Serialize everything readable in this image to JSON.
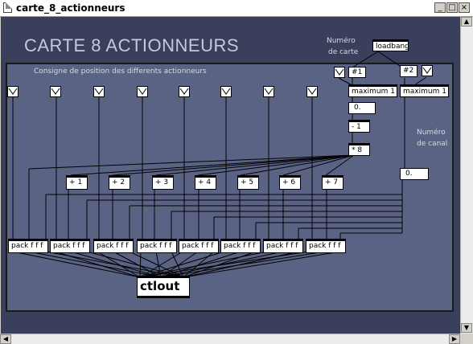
{
  "window": {
    "title": "carte_8_actionneurs"
  },
  "header": {
    "title": "CARTE 8 ACTIONNEURS",
    "card_label_line1": "Numéro",
    "card_label_line2": "de carte"
  },
  "panel": {
    "caption": "Consigne de position des differents actionneurs",
    "channel_label_line1": "Numéro",
    "channel_label_line2": "de canal"
  },
  "objects": {
    "loadbang": "loadbang",
    "msg1": "#1",
    "msg2": "#2",
    "max1": "maximum 1",
    "max2": "maximum 1",
    "num1": "0.",
    "minus": "- 1",
    "times": "* 8",
    "num2": "0.",
    "adds": [
      "+ 1",
      "+ 2",
      "+ 3",
      "+ 4",
      "+ 5",
      "+ 6",
      "+ 7"
    ],
    "packs": [
      "pack f f f",
      "pack f f f",
      "pack f f f",
      "pack f f f",
      "pack f f f",
      "pack f f f",
      "pack f f f",
      "pack f f f"
    ],
    "ctlout": "ctlout"
  },
  "window_buttons": {
    "minimize": "_",
    "maximize": "□",
    "close": "×"
  },
  "colors": {
    "canvas": "#3a3f5c",
    "panel": "#5b6385",
    "title_text": "#c8c8d8"
  }
}
